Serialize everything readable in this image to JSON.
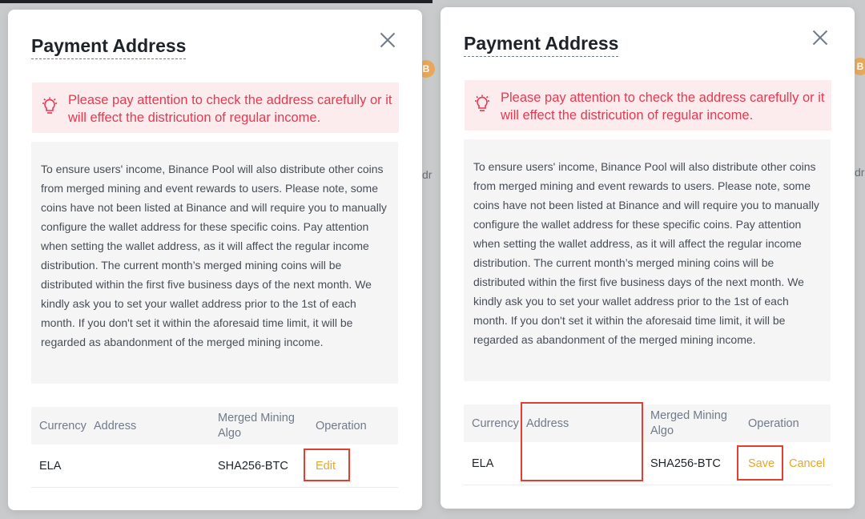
{
  "background": {
    "coin_symbol": "B",
    "partial_text": "dr"
  },
  "modal_left": {
    "title": "Payment Address",
    "warning": "Please pay attention to check the address carefully or it will effect the districution of regular income.",
    "info": "To ensure users' income, Binance Pool will also distribute other coins from merged mining and event rewards to users. Please note, some coins have not been listed at Binance and will require you to manually configure the wallet address for these specific coins. Pay attention when setting the wallet address, as it will affect the regular income distribution. The current month’s merged mining coins will be distributed within the first five business days of the next month. We kindly ask you to set your wallet address prior to the 1st of each month. If you don't set it within the aforesaid time limit, it will be regarded as abandonment of the merged mining income.",
    "table": {
      "headers": {
        "currency": "Currency",
        "address": "Address",
        "algo": "Merged Mining Algo",
        "operation": "Operation"
      },
      "row": {
        "currency": "ELA",
        "address": "",
        "algo": "SHA256-BTC",
        "edit": "Edit"
      }
    }
  },
  "modal_right": {
    "title": "Payment Address",
    "warning": "Please pay attention to check the address carefully or it will effect the districution of regular income.",
    "info": "To ensure users' income, Binance Pool will also distribute other coins from merged mining and event rewards to users. Please note, some coins have not been listed at Binance and will require you to manually configure the wallet address for these specific coins. Pay attention when setting the wallet address, as it will affect the regular income distribution. The current month’s merged mining coins will be distributed within the first five business days of the next month. We kindly ask you to set your wallet address prior to the 1st of each month. If you don't set it within the aforesaid time limit, it will be regarded as abandonment of the merged mining income.",
    "table": {
      "headers": {
        "currency": "Currency",
        "address": "Address",
        "algo": "Merged Mining Algo",
        "operation": "Operation"
      },
      "row": {
        "currency": "ELA",
        "address": "",
        "algo": "SHA256-BTC",
        "save": "Save",
        "cancel": "Cancel"
      }
    }
  },
  "colors": {
    "accent": "#e7a72f",
    "warning": "#e8384f",
    "highlight": "#e23e31"
  }
}
